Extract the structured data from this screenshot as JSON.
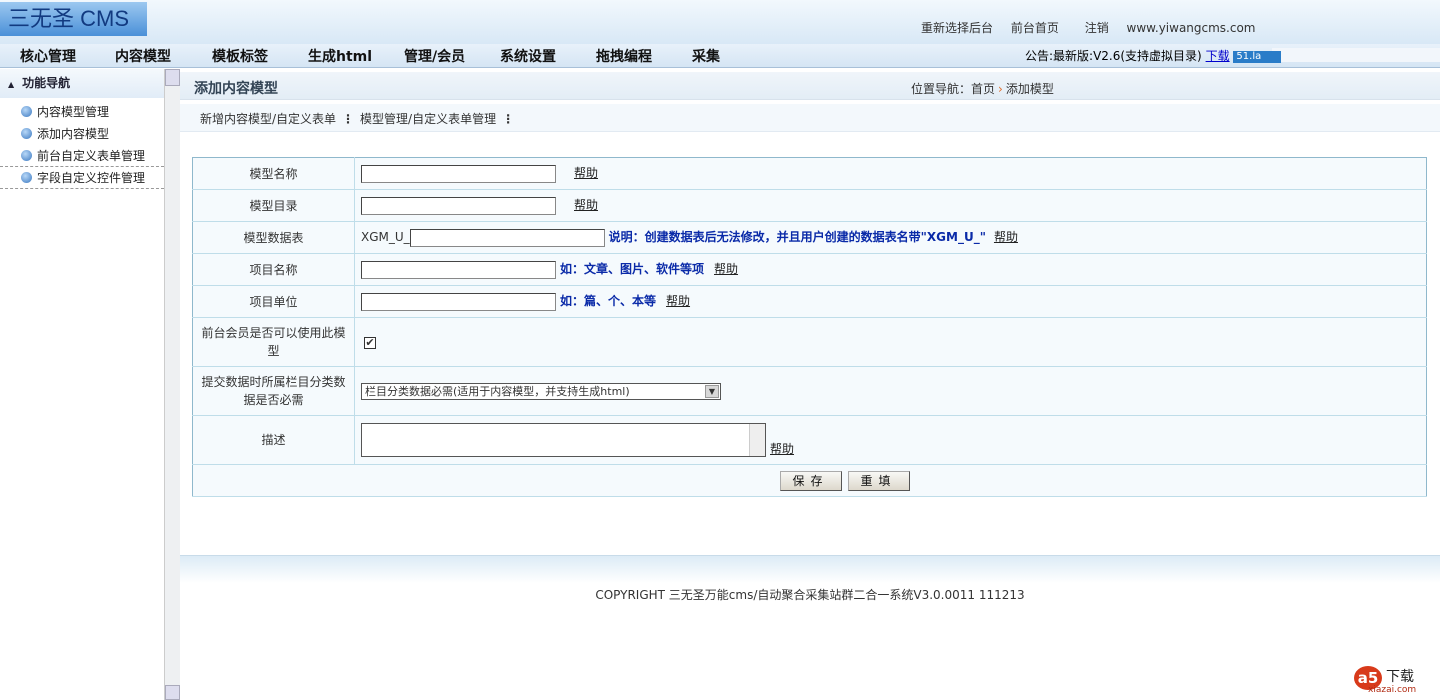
{
  "header": {
    "logo": "三无圣 CMS",
    "links": [
      "重新选择后台",
      "前台首页",
      "注销",
      "www.yiwangcms.com"
    ]
  },
  "nav": {
    "items": [
      "核心管理",
      "内容模型",
      "模板标签",
      "生成html",
      "管理/会员",
      "系统设置",
      "拖拽编程",
      "采集"
    ],
    "notice": "公告:最新版:V2.6(支持虚拟目录)",
    "notice_link": "下载",
    "badge": "51.la"
  },
  "sidebar": {
    "title": "功能导航",
    "items": [
      "内容模型管理",
      "添加内容模型",
      "前台自定义表单管理",
      "字段自定义控件管理"
    ]
  },
  "main": {
    "title": "添加内容模型",
    "breadcrumb_label": "位置导航：",
    "breadcrumb": [
      "首页",
      "添加模型"
    ],
    "subnav": [
      "新增内容模型/自定义表单",
      "模型管理/自定义表单管理"
    ],
    "sep": "⋮"
  },
  "form": {
    "help": "帮助",
    "rows": [
      {
        "label": "模型名称",
        "value": ""
      },
      {
        "label": "模型目录",
        "value": ""
      },
      {
        "label": "模型数据表",
        "prefix": "XGM_U_",
        "value": "",
        "tip": "说明：创建数据表后无法修改，并且用户创建的数据表名带\"XGM_U_\""
      },
      {
        "label": "项目名称",
        "value": "",
        "tip": "如：文章、图片、软件等项"
      },
      {
        "label": "项目单位",
        "value": "",
        "tip": "如：篇、个、本等"
      },
      {
        "label": "前台会员是否可以使用此模型",
        "checked": true,
        "check_mark": "✔"
      },
      {
        "label": "提交数据时所属栏目分类数据是否必需",
        "selected": "栏目分类数据必需(适用于内容模型，并支持生成html)"
      },
      {
        "label": "描述",
        "value": ""
      }
    ],
    "save": "保存",
    "reset": "重填"
  },
  "footer": {
    "copyright": "COPYRIGHT 三无圣万能cms/自动聚合采集站群二合一系统V3.0.0011 111213"
  },
  "watermark": {
    "logo": "a5",
    "text": "下载",
    "domain": "xiazai.com"
  }
}
